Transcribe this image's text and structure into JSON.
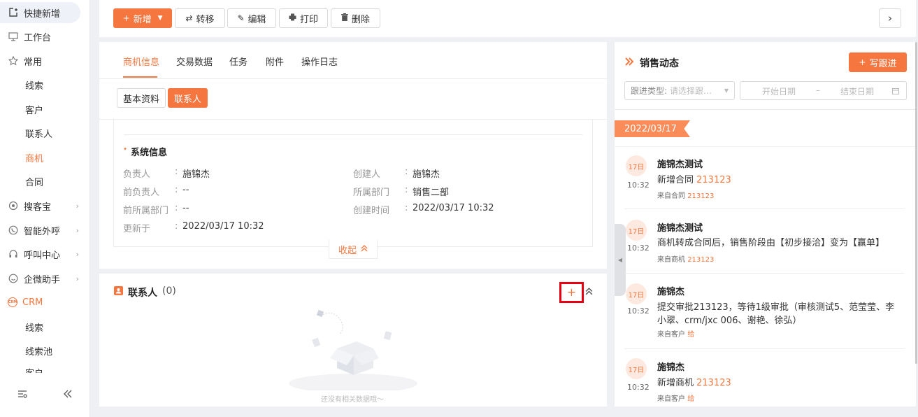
{
  "sidebar": {
    "items": [
      {
        "label": "快捷新增",
        "icon": "add-box-icon"
      },
      {
        "label": "工作台",
        "icon": "monitor-icon"
      },
      {
        "label": "常用",
        "icon": "star-icon"
      },
      {
        "label": "线索"
      },
      {
        "label": "客户"
      },
      {
        "label": "联系人"
      },
      {
        "label": "商机"
      },
      {
        "label": "合同"
      },
      {
        "label": "搜客宝",
        "icon": "search-treasure-icon"
      },
      {
        "label": "智能外呼",
        "icon": "phone-icon"
      },
      {
        "label": "呼叫中心",
        "icon": "headset-icon"
      },
      {
        "label": "企微助手",
        "icon": "wecom-icon"
      },
      {
        "label": "CRM",
        "icon": "crm-icon"
      },
      {
        "label": "线索"
      },
      {
        "label": "线索池"
      },
      {
        "label": "客户"
      }
    ],
    "crm_icon_text": "CRM"
  },
  "toolbar": {
    "new_label": "新增",
    "transfer_label": "转移",
    "edit_label": "编辑",
    "print_label": "打印",
    "delete_label": "删除"
  },
  "tabs": [
    "商机信息",
    "交易数据",
    "任务",
    "附件",
    "操作日志"
  ],
  "subtabs": [
    "基本资料",
    "联系人"
  ],
  "system_info": {
    "title": "系统信息",
    "fields": [
      {
        "label": "负责人",
        "value": "施锦杰"
      },
      {
        "label": "创建人",
        "value": "施锦杰"
      },
      {
        "label": "前负责人",
        "value": "--"
      },
      {
        "label": "所属部门",
        "value": "销售二部"
      },
      {
        "label": "前所属部门",
        "value": "--"
      },
      {
        "label": "创建时间",
        "value": "2022/03/17 10:32"
      },
      {
        "label": "更新于",
        "value": "2022/03/17 10:32"
      }
    ],
    "collapse_label": "收起"
  },
  "contacts": {
    "title": "联系人",
    "count": "(0)",
    "empty_text": "还没有相关数据哦～"
  },
  "sales": {
    "title": "销售动态",
    "write_label": "写跟进",
    "filter_label": "跟进类型:",
    "filter_placeholder": "请选择跟…",
    "start_date": "开始日期",
    "end_date": "结束日期",
    "date_sep": "–",
    "date": "2022/03/17",
    "feed": [
      {
        "day": "17日",
        "time": "10:32",
        "title": "施锦杰测试",
        "text_prefix": "新增合同 ",
        "text_link": "213123",
        "src_prefix": "来自合同 ",
        "src_link": "213123"
      },
      {
        "day": "17日",
        "time": "10:32",
        "title": "施锦杰测试",
        "text_prefix": "商机转成合同后，销售阶段由【初步接洽】变为【赢单】",
        "text_link": "",
        "src_prefix": "来自商机 ",
        "src_link": "213123"
      },
      {
        "day": "17日",
        "time": "10:32",
        "title": "施锦杰",
        "text_prefix": "提交审批213123，等待1级审批（审核测试5、范莹莹、李小翠、crm/jxc 006、谢艳、徐弘）",
        "text_link": "",
        "src_prefix": "来自客户 ",
        "src_link": "给"
      },
      {
        "day": "17日",
        "time": "10:32",
        "title": "施锦杰",
        "text_prefix": "新增商机 ",
        "text_link": "213123",
        "src_prefix": "来自客户 ",
        "src_link": "给"
      }
    ]
  },
  "colors": {
    "accent": "#f5763f",
    "highlight": "#e60012"
  }
}
